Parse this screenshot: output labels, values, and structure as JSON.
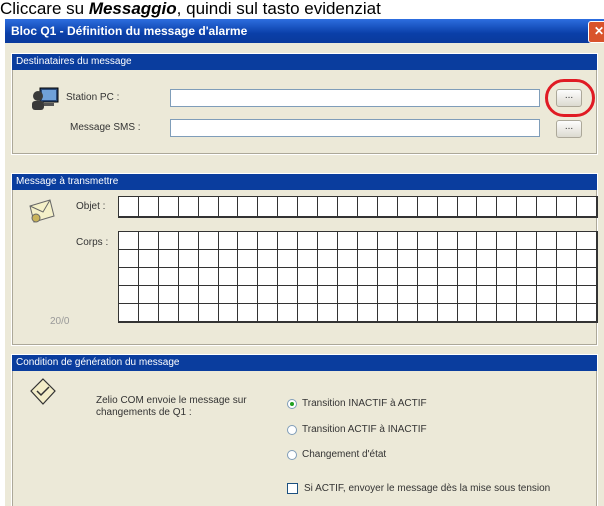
{
  "caption": {
    "prefix": "Cliccare su ",
    "emphasis": "Messaggio",
    "suffix": ", quindi sul tasto evidenziat"
  },
  "window": {
    "title": "Bloc Q1 - Définition du message d'alarme"
  },
  "recipients": {
    "header": "Destinataires du message",
    "station_label": "Station PC :",
    "station_value": "",
    "sms_label": "Message SMS :",
    "sms_value": "",
    "browse_label": "..."
  },
  "message": {
    "header": "Message à transmettre",
    "object_label": "Objet :",
    "body_label": "Corps :",
    "counter": "20/0",
    "object_cells": 24,
    "body_cols": 24,
    "body_rows": 5
  },
  "condition": {
    "header": "Condition de génération du message",
    "description": "Zelio COM envoie le message sur changements de Q1 :",
    "options": [
      {
        "label": "Transition INACTIF à ACTIF",
        "selected": true
      },
      {
        "label": "Transition ACTIF à INACTIF",
        "selected": false
      },
      {
        "label": "Changement d'état",
        "selected": false
      }
    ],
    "checkbox_label": "Si ACTIF, envoyer le message dès la mise sous tension",
    "checkbox_checked": false
  }
}
